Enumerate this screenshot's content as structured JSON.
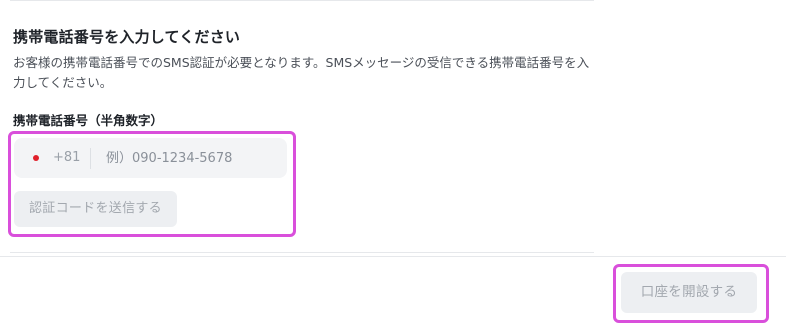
{
  "form": {
    "title": "携帯電話番号を入力してください",
    "description": "お客様の携帯電話番号でのSMS認証が必要となります。SMSメッセージの受信できる携帯電話番号を入力してください。",
    "field_label": "携帯電話番号（半角数字）",
    "country_flag_icon": "japan-flag-icon",
    "country_code": "+81",
    "phone_placeholder": "例）090-1234-5678",
    "phone_value": "",
    "send_code_label": "認証コードを送信する"
  },
  "footer": {
    "open_account_label": "口座を開設する"
  },
  "colors": {
    "highlight": "#d94fdb",
    "disabled_button_bg": "#edeff2",
    "disabled_button_text": "#a3a8af",
    "input_bg": "#f3f4f6",
    "flag_red": "#e0202b"
  }
}
